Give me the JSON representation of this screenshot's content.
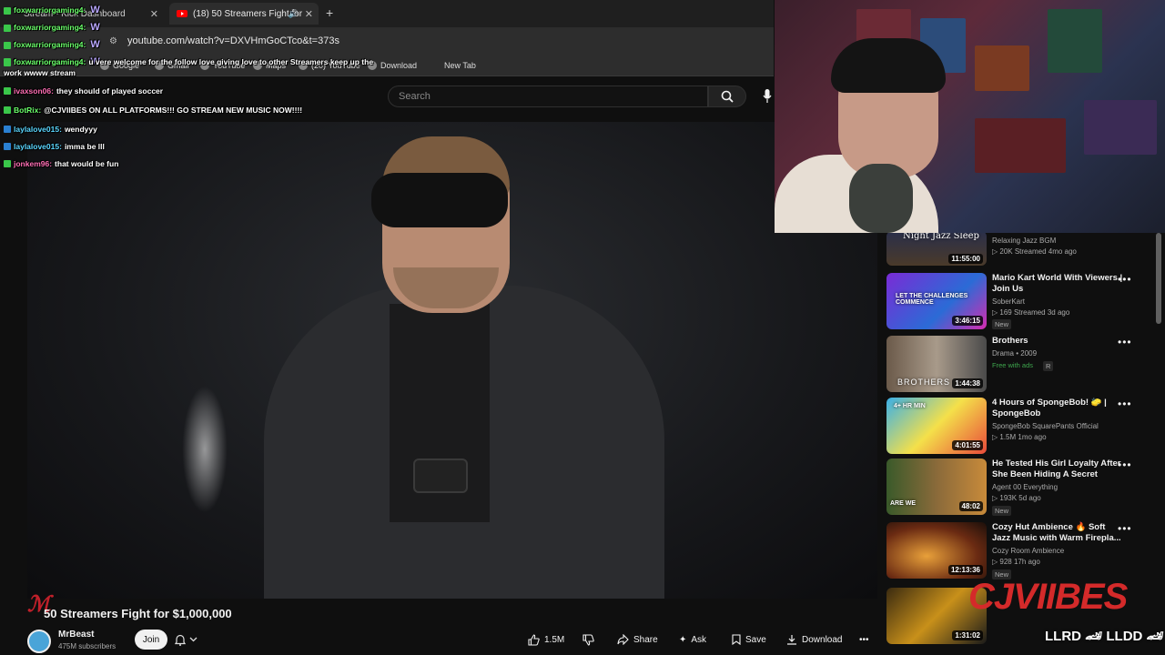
{
  "browser": {
    "tabs": [
      {
        "label": "Stream - Kick Dashboard",
        "close": "✕"
      },
      {
        "label": "(18) 50 Streamers Fight for",
        "close": "✕"
      }
    ],
    "new_tab": "+",
    "url": "youtube.com/watch?v=DXVHmGoCTco&t=373s",
    "bookmarks": [
      "Google",
      "Gmail",
      "YouTube",
      "Maps",
      "(20) YouTube",
      "Download",
      "New Tab"
    ]
  },
  "youtube": {
    "search_placeholder": "Search"
  },
  "video": {
    "title": "50 Streamers Fight for $1,000,000",
    "channel": "MrBeast",
    "subscribers": "475M subscribers",
    "join_label": "Join",
    "likes": "1.5M",
    "share_label": "Share",
    "ask_label": "Ask",
    "save_label": "Save",
    "download_label": "Download",
    "more_label": "•••"
  },
  "chat": [
    {
      "user": "foxwarriorgaming4:",
      "message": "W",
      "badge": "green"
    },
    {
      "user": "foxwarriorgaming4:",
      "message": "W",
      "badge": "green"
    },
    {
      "user": "foxwarriorgaming4:",
      "message": "W",
      "badge": "green"
    },
    {
      "user": "foxwarriorgaming4:",
      "message": "W",
      "badge": "green"
    },
    {
      "user": "foxwarriorgaming4:",
      "message": "u vere welcome for the follow love giving love to other Streamers keep up the",
      "badge": "green"
    },
    {
      "user": "",
      "message": "work wwww stream",
      "badge": ""
    },
    {
      "user": "ivaxson06:",
      "message": "they should of played soccer",
      "badge": "green"
    },
    {
      "user": "BotRix:",
      "message": "@CJVIIBES ON ALL PLATFORMS!!! GO STREAM NEW MUSIC NOW!!!!",
      "badge": "green"
    },
    {
      "user": "laylalove015:",
      "message": "wendyyy",
      "badge": "blue"
    },
    {
      "user": "laylalove015:",
      "message": "imma be lll",
      "badge": "blue"
    },
    {
      "user": "jonkem96:",
      "message": "that would be fun",
      "badge": "green"
    }
  ],
  "recommendations": [
    {
      "title": "",
      "channel": "Relaxing Jazz BGM",
      "meta": "▷ 20K  Streamed 4mo ago",
      "duration": "11:55:00",
      "thumb_text": "Night Jazz Sleep",
      "badge": ""
    },
    {
      "title": "Mario Kart World With Viewers | Join Us",
      "channel": "SoberKart",
      "meta": "▷ 169  Streamed 3d ago",
      "duration": "3:46:15",
      "thumb_text": "LET THE CHALLENGES COMMENCE",
      "badge": "New"
    },
    {
      "title": "Brothers",
      "channel": "Drama • 2009",
      "meta": "",
      "duration": "1:44:38",
      "thumb_text": "BROTHERS",
      "badge": "Free with ads",
      "badge2": "R"
    },
    {
      "title": "4 Hours of SpongeBob! 🧽 | SpongeBob",
      "channel": "SpongeBob SquarePants Official",
      "meta": "▷ 1.5M  1mo ago",
      "duration": "4:01:55",
      "thumb_text": "4+ HR MIN",
      "badge": ""
    },
    {
      "title": "He Tested His Girl Loyalty After She Been Hiding A Secret",
      "channel": "Agent 00 Everything",
      "meta": "▷ 193K  5d ago",
      "duration": "48:02",
      "thumb_text": "ARE WE",
      "badge": "New"
    },
    {
      "title": "Cozy Hut Ambience 🔥 Soft Jazz Music with Warm Firepla...",
      "channel": "Cozy Room Ambience",
      "meta": "▷ 928  17h ago",
      "duration": "12:13:36",
      "thumb_text": "",
      "badge": "New"
    },
    {
      "title": "",
      "channel": "",
      "meta": "",
      "duration": "1:31:02",
      "thumb_text": "",
      "badge": ""
    }
  ],
  "overlay": {
    "brand": "CJVIIBES",
    "brand_sub": "LLRD 🏎 LLDD 🏎"
  },
  "colors": {
    "background": "#0f0f0f",
    "accent": "#ff0000",
    "brand_red": "#d42a2a"
  }
}
